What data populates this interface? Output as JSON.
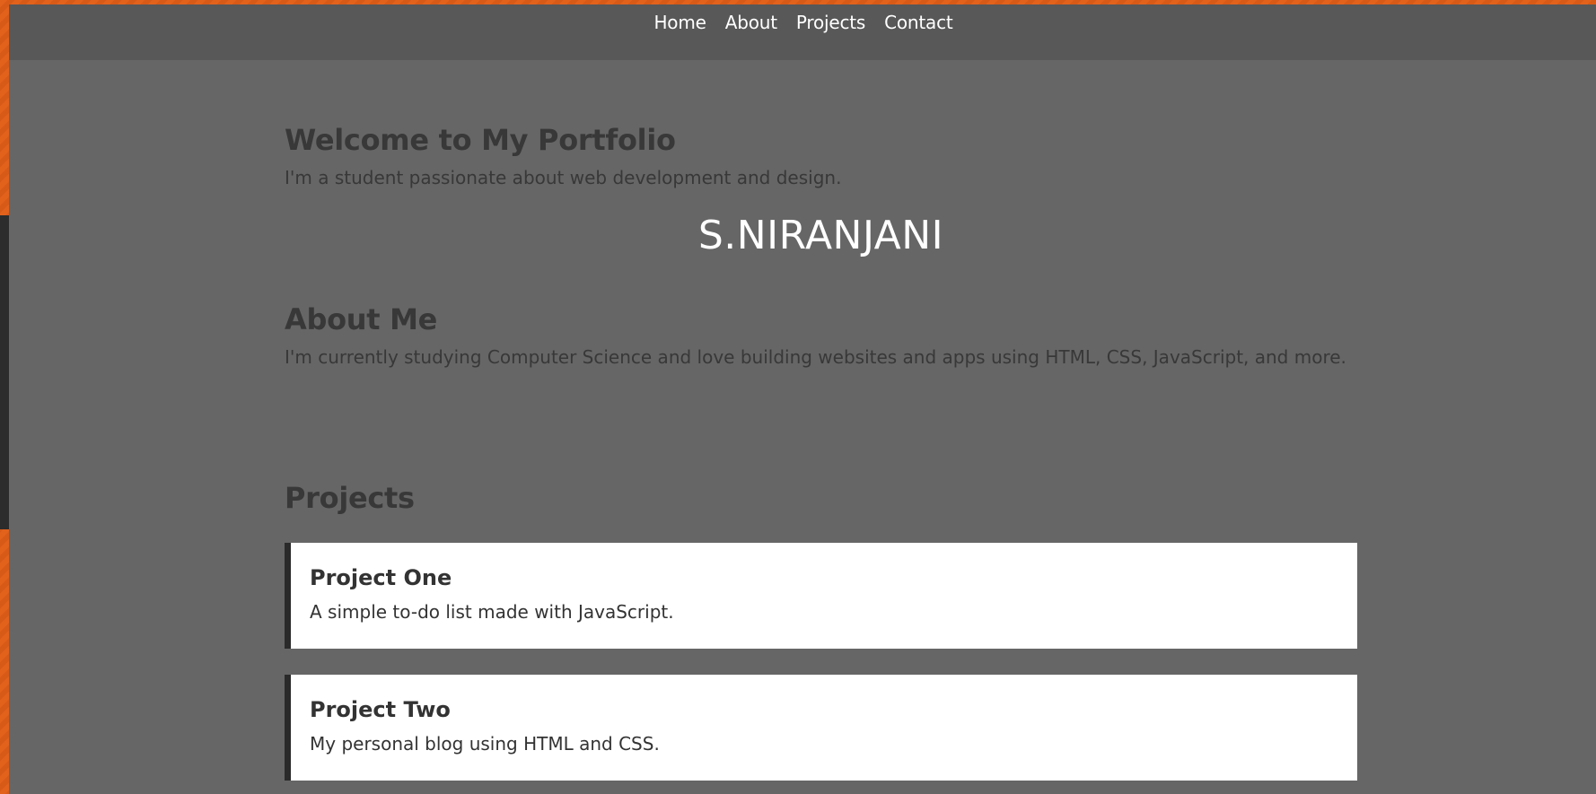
{
  "nav": {
    "links": [
      "Home",
      "About",
      "Projects",
      "Contact"
    ]
  },
  "hero": {
    "title": "Welcome to My Portfolio",
    "subtitle": "I'm a student passionate about web development and design.",
    "name": "S.NIRANJANI"
  },
  "about": {
    "title": "About Me",
    "text": "I'm currently studying Computer Science and love building websites and apps using HTML, CSS, JavaScript, and more."
  },
  "projects": {
    "title": "Projects",
    "items": [
      {
        "title": "Project One",
        "description": "A simple to-do list made with JavaScript."
      },
      {
        "title": "Project Two",
        "description": "My personal blog using HTML and CSS."
      }
    ]
  },
  "colors": {
    "background_accent": "#e2621c",
    "page": "#666666",
    "navbar": "#585858",
    "card": "#ffffff",
    "card_border": "#2a2a2a"
  }
}
